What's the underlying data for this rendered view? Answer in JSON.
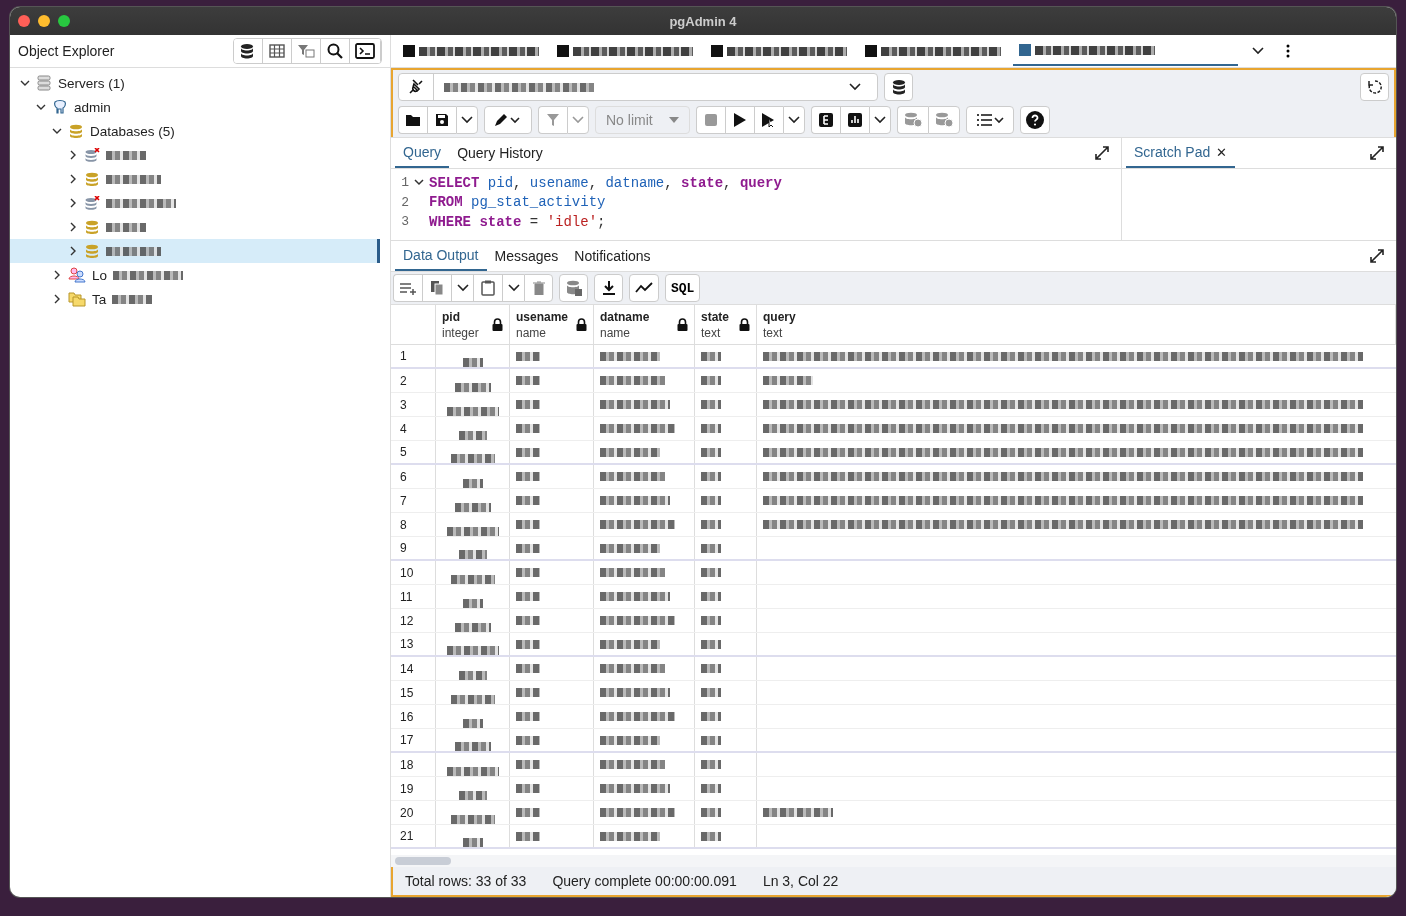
{
  "window": {
    "title": "pgAdmin 4"
  },
  "object_explorer": {
    "title": "Object Explorer",
    "tree": [
      {
        "label": "Servers (1)",
        "kind": "servers",
        "expanded": true,
        "selected": false,
        "children": [
          {
            "label": "admin",
            "kind": "server",
            "expanded": true,
            "selected": false,
            "children": [
              {
                "label": "Databases (5)",
                "kind": "databases",
                "expanded": true,
                "selected": false,
                "children": [
                  {
                    "kind": "db-off",
                    "expanded": false,
                    "selected": false
                  },
                  {
                    "kind": "db",
                    "expanded": false,
                    "selected": false
                  },
                  {
                    "kind": "db-off",
                    "expanded": false,
                    "selected": false
                  },
                  {
                    "kind": "db",
                    "expanded": false,
                    "selected": false
                  },
                  {
                    "kind": "db",
                    "expanded": false,
                    "selected": true
                  }
                ]
              },
              {
                "label": "Lo",
                "kind": "roles",
                "expanded": false,
                "selected": false
              },
              {
                "label": "Ta",
                "kind": "tablespaces",
                "expanded": false,
                "selected": false
              }
            ]
          }
        ]
      }
    ]
  },
  "doc_tabs": [
    {
      "selected": false
    },
    {
      "selected": false
    },
    {
      "selected": false
    },
    {
      "selected": false
    },
    {
      "selected": true
    }
  ],
  "toolbar": {
    "limit": "No limit"
  },
  "editor_tabs": [
    {
      "label": "Query",
      "selected": true
    },
    {
      "label": "Query History",
      "selected": false
    }
  ],
  "scratch_pad": {
    "label": "Scratch Pad",
    "close": "✕"
  },
  "code": [
    {
      "number": "1",
      "tokens": [
        {
          "text": "SELECT",
          "kind": "keyword"
        },
        {
          "text": " pid",
          "kind": "identifier"
        },
        {
          "text": ",",
          "kind": "punct"
        },
        {
          "text": " usename",
          "kind": "identifier"
        },
        {
          "text": ",",
          "kind": "punct"
        },
        {
          "text": " datname",
          "kind": "identifier"
        },
        {
          "text": ",",
          "kind": "punct"
        },
        {
          "text": " state",
          "kind": "keyword"
        },
        {
          "text": ",",
          "kind": "punct"
        },
        {
          "text": " query",
          "kind": "keyword"
        }
      ]
    },
    {
      "number": "2",
      "tokens": [
        {
          "text": "FROM",
          "kind": "keyword"
        },
        {
          "text": " pg_stat_activity",
          "kind": "identifier"
        }
      ]
    },
    {
      "number": "3",
      "tokens": [
        {
          "text": "WHERE",
          "kind": "keyword"
        },
        {
          "text": " state",
          "kind": "keyword"
        },
        {
          "text": " =",
          "kind": "punct"
        },
        {
          "text": " 'idle'",
          "kind": "string"
        },
        {
          "text": ";",
          "kind": "punct"
        }
      ]
    }
  ],
  "output_tabs": [
    {
      "label": "Data Output",
      "selected": true
    },
    {
      "label": "Messages",
      "selected": false
    },
    {
      "label": "Notifications",
      "selected": false
    }
  ],
  "output_toolbar": {
    "sql": "SQL"
  },
  "table": {
    "columns": [
      {
        "name": "pid",
        "type": "integer"
      },
      {
        "name": "usename",
        "type": "name"
      },
      {
        "name": "datname",
        "type": "name"
      },
      {
        "name": "state",
        "type": "text"
      },
      {
        "name": "query",
        "type": "text"
      }
    ],
    "rows": [
      {
        "number": "1",
        "query_shown": true
      },
      {
        "number": "2",
        "query_shown": true
      },
      {
        "number": "3",
        "query_shown": true
      },
      {
        "number": "4",
        "query_shown": true
      },
      {
        "number": "5",
        "query_shown": true
      },
      {
        "number": "6",
        "query_shown": true
      },
      {
        "number": "7",
        "query_shown": true
      },
      {
        "number": "8",
        "query_shown": true
      },
      {
        "number": "9",
        "query_shown": false
      },
      {
        "number": "10",
        "query_shown": false
      },
      {
        "number": "11",
        "query_shown": false
      },
      {
        "number": "12",
        "query_shown": false
      },
      {
        "number": "13",
        "query_shown": false
      },
      {
        "number": "14",
        "query_shown": false
      },
      {
        "number": "15",
        "query_shown": false
      },
      {
        "number": "16",
        "query_shown": false
      },
      {
        "number": "17",
        "query_shown": false
      },
      {
        "number": "18",
        "query_shown": false
      },
      {
        "number": "19",
        "query_shown": false
      },
      {
        "number": "20",
        "query_shown": true
      },
      {
        "number": "21",
        "query_shown": false
      }
    ]
  },
  "status_bar": [
    "Total rows: 33 of 33",
    "Query complete 00:00:00.091",
    "Ln 3, Col 22"
  ]
}
